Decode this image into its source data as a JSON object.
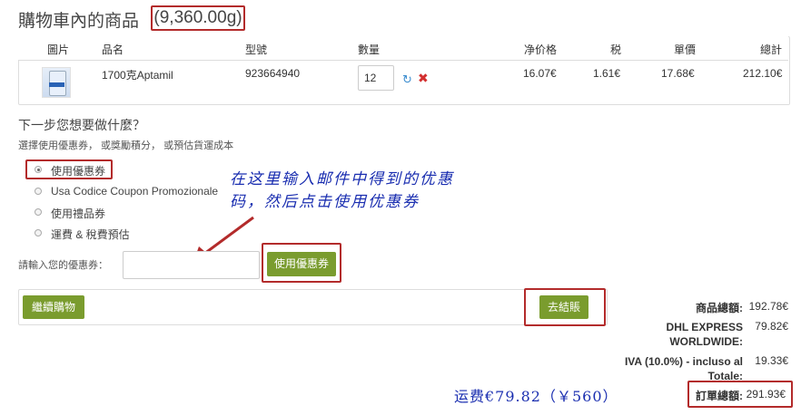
{
  "header": {
    "title": "購物車內的商品",
    "weight": "(9,360.00g)"
  },
  "table": {
    "columns": [
      "圖片",
      "品名",
      "型號",
      "數量",
      "净价格",
      "税",
      "單價",
      "總計"
    ],
    "row": {
      "name": "1700克Aptamil",
      "model": "923664940",
      "quantity": "12",
      "net_price": "16.07€",
      "tax": "1.61€",
      "unit_price": "17.68€",
      "total": "212.10€"
    }
  },
  "next_steps": {
    "title": "下一步您想要做什麼？",
    "subtitle": "選擇使用優惠券， 或獎勵積分， 或預估貨運成本",
    "options": [
      "使用優惠券",
      "Usa Codice Coupon Promozionale",
      "使用禮品券",
      "運費 & 稅費預估"
    ],
    "selected": "使用優惠券"
  },
  "annotation": {
    "instruction": "在这里输入邮件中得到的优惠码，然后点击使用优惠券",
    "shipping_note": "运费€79.82（￥560）"
  },
  "coupon": {
    "label": "請輸入您的優惠券：",
    "value": "",
    "button": "使用優惠券"
  },
  "cart": {
    "continue_button": "繼續購物",
    "checkout_button": "去結賬"
  },
  "totals": {
    "subtotal_label": "商品總額:",
    "subtotal": "192.78€",
    "shipping_label": "DHL EXPRESS WORLDWIDE:",
    "shipping": "79.82€",
    "iva_label": "IVA (10.0%) - incluso al Totale:",
    "iva": "19.33€",
    "order_total_label": "訂單總額:",
    "order_total": "291.93€"
  },
  "colors": {
    "accent_green": "#7a9c2e",
    "highlight_red": "#b32b2b",
    "annotation_blue": "#1a2eb0"
  }
}
